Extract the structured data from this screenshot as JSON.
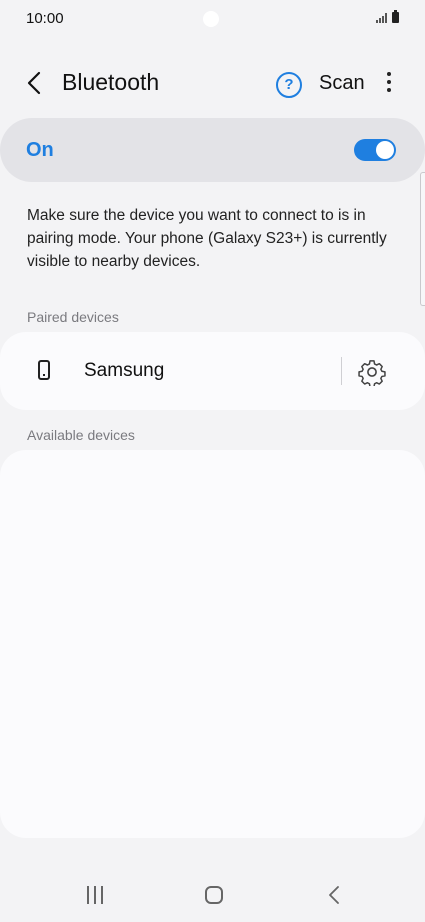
{
  "status_bar": {
    "time": "10:00",
    "icons": [
      "signal-icon",
      "battery-icon"
    ]
  },
  "header": {
    "title": "Bluetooth",
    "help_icon": "help-icon",
    "scan_label": "Scan",
    "more_icon": "more-options-icon",
    "back_icon": "back-arrow-icon"
  },
  "master_toggle": {
    "label": "On",
    "state": "on"
  },
  "description": "Make sure the device you want to connect to is in pairing mode. Your phone (Galaxy S23+) is currently visible to nearby devices.",
  "paired": {
    "header": "Paired devices",
    "devices": [
      {
        "name": "Samsung",
        "icon": "phone-icon",
        "settings_icon": "gear-icon"
      }
    ]
  },
  "available": {
    "header": "Available devices",
    "devices": []
  },
  "navigation": {
    "recents": "recents-icon",
    "home": "home-icon",
    "back": "back-icon"
  },
  "colors": {
    "accent": "#1f7fe0",
    "background": "#f3f3f5",
    "card": "#fbfbfd",
    "toggle_row": "#e3e3e7"
  }
}
